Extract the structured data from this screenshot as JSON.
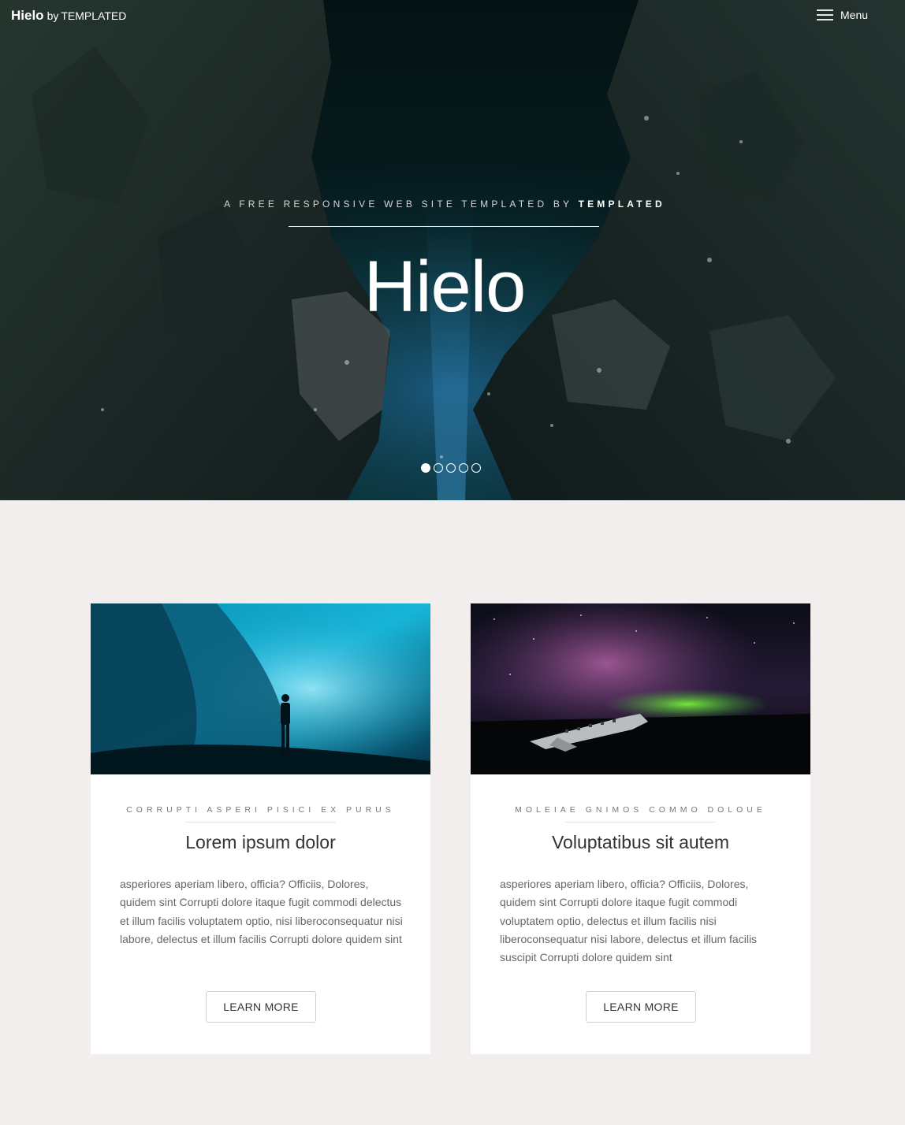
{
  "header": {
    "logo_main": "Hielo",
    "logo_by": "by",
    "logo_brand": "TEMPLATED",
    "menu_label": "Menu"
  },
  "hero": {
    "tagline_prefix": "A free responsive web site templated by",
    "tagline_brand": "TEMPLATED",
    "title": "Hielo",
    "slides": 5,
    "active_slide": 1
  },
  "cards": [
    {
      "kicker": "Corrupti asperi pisici ex purus",
      "title": "Lorem ipsum dolor",
      "body": "asperiores aperiam libero, officia? Officiis, Dolores, quidem sint Corrupti dolore itaque fugit commodi delectus et illum facilis voluptatem optio, nisi liberoconsequatur nisi labore, delectus et illum facilis Corrupti dolore quidem sint",
      "button": "Learn More",
      "image": "ice-cave-photo"
    },
    {
      "kicker": "Moleiae gnimos commo doloue",
      "title": "Voluptatibus sit autem",
      "body": "asperiores aperiam libero, officia? Officiis, Dolores, quidem sint Corrupti dolore itaque fugit commodi voluptatem optio, delectus et illum facilis nisi liberoconsequatur nisi labore, delectus et illum facilis suscipit Corrupti dolore quidem sint",
      "button": "Learn More",
      "image": "aurora-plane-wreck-photo"
    }
  ],
  "colors": {
    "page_bg": "#f1eeed",
    "card_bg": "#ffffff",
    "hero_bg": "#06181a"
  }
}
